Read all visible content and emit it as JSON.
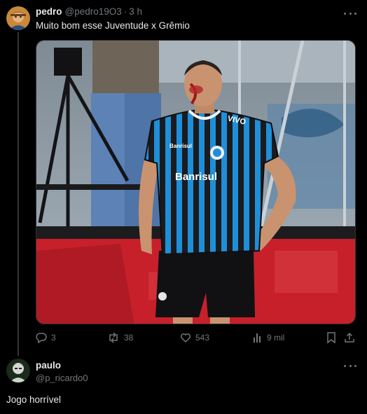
{
  "post": {
    "author_name": "pedro",
    "author_handle": "@pedro19O3",
    "time": "3 h",
    "text": "Muito bom esse Juventude x Grêmio",
    "media": {
      "sponsor_text": "Banrisul",
      "sleeve_text": "Banrisul",
      "shoulder_text": "VIVO"
    },
    "actions": {
      "replies": "3",
      "reposts": "38",
      "likes": "543",
      "views": "9 mil"
    }
  },
  "reply": {
    "author_name": "paulo",
    "author_handle": "@p_ricardo0",
    "text": "Jogo horrível"
  },
  "colors": {
    "background": "#000000",
    "text_primary": "#e7e9ea",
    "text_secondary": "#71767b",
    "board_red": "#c8202a",
    "jersey_blue": "#1e8fd8"
  }
}
